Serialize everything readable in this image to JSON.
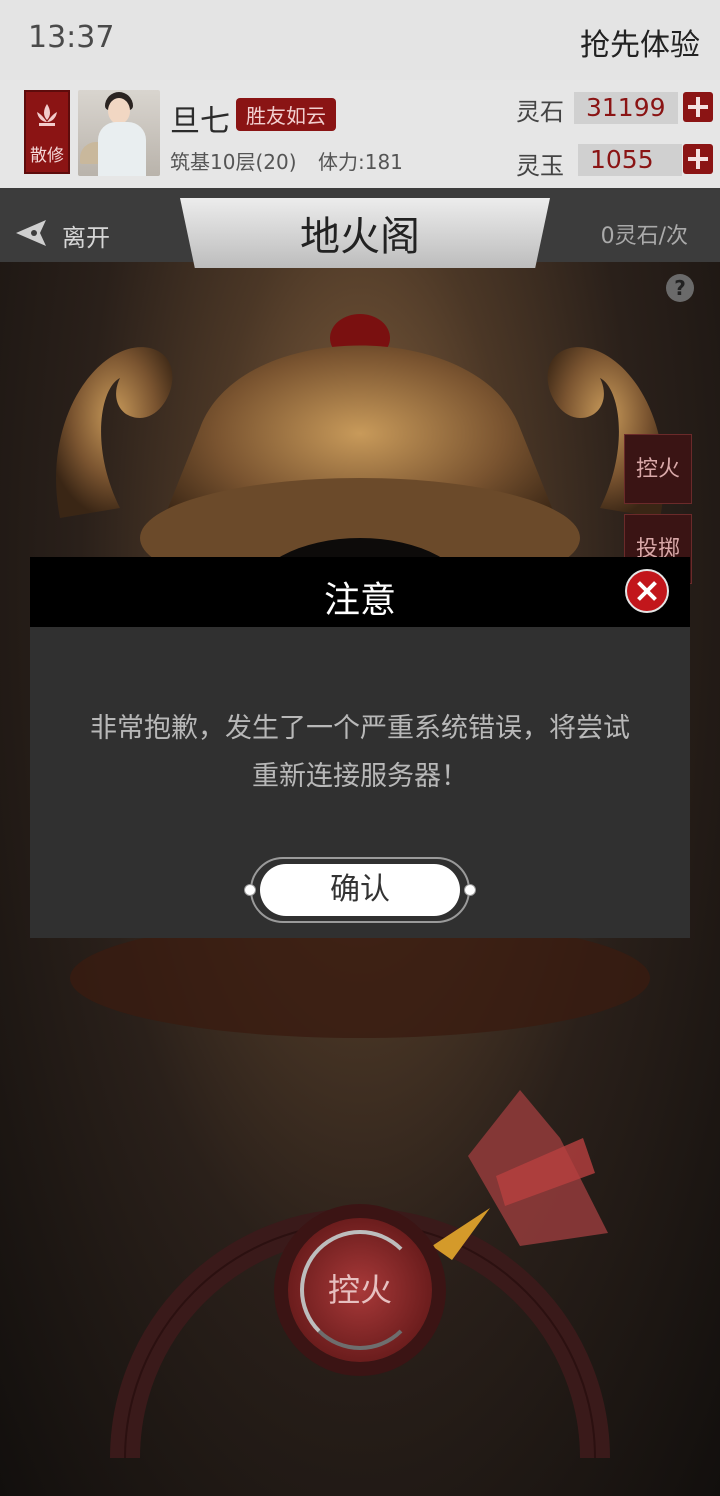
{
  "status_bar": {
    "time": "13:37",
    "action": "抢先体验"
  },
  "player": {
    "sect_badge": "散修",
    "name": "旦七",
    "tag": "胜友如云",
    "level": "筑基10层(20)",
    "stamina": "体力:181",
    "resources": [
      {
        "label": "灵石",
        "value": "31199"
      },
      {
        "label": "灵玉",
        "value": "1055"
      }
    ]
  },
  "game": {
    "leave_label": "离开",
    "title": "地火阁",
    "cost": "0灵石/次",
    "help": "?",
    "side_buttons": [
      "控火",
      "投掷"
    ],
    "control_label": "控火"
  },
  "dialog": {
    "title": "注意",
    "message": "非常抱歉，发生了一个严重系统错误，将尝试重新连接服务器！",
    "confirm_label": "确认"
  }
}
